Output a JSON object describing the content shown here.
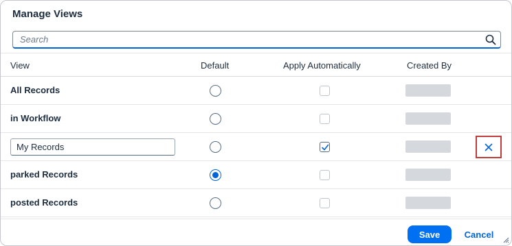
{
  "dialog": {
    "title": "Manage Views"
  },
  "search": {
    "placeholder": "Search",
    "icon": "search-icon"
  },
  "columns": {
    "view": "View",
    "default": "Default",
    "apply": "Apply Automatically",
    "created_by": "Created By"
  },
  "rows": [
    {
      "name": "All Records",
      "editable": false,
      "default": false,
      "apply": false
    },
    {
      "name": "in Workflow",
      "editable": false,
      "default": false,
      "apply": false
    },
    {
      "name": "My Records",
      "editable": true,
      "default": false,
      "apply": true,
      "deletable": true
    },
    {
      "name": "parked Records",
      "editable": false,
      "default": true,
      "apply": false
    },
    {
      "name": "posted Records",
      "editable": false,
      "default": false,
      "apply": false
    }
  ],
  "footer": {
    "save_label": "Save",
    "cancel_label": "Cancel"
  },
  "colors": {
    "accent": "#0070f2",
    "highlight": "#c23b3b"
  }
}
